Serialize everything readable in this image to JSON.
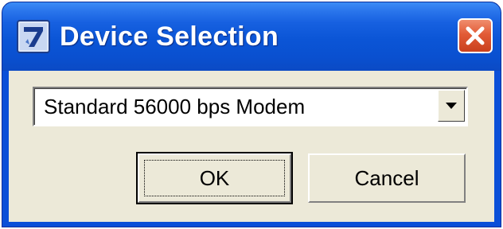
{
  "window": {
    "title": "Device Selection",
    "app_icon": "device-app-icon",
    "close_icon": "close-icon"
  },
  "device_select": {
    "selected_value": "Standard 56000 bps Modem",
    "arrow_icon": "chevron-down-icon"
  },
  "buttons": {
    "ok_label": "OK",
    "cancel_label": "Cancel"
  },
  "colors": {
    "titlebar": "#0a50d0",
    "close_button": "#e25b36",
    "dialog_background": "#ece9d8"
  }
}
